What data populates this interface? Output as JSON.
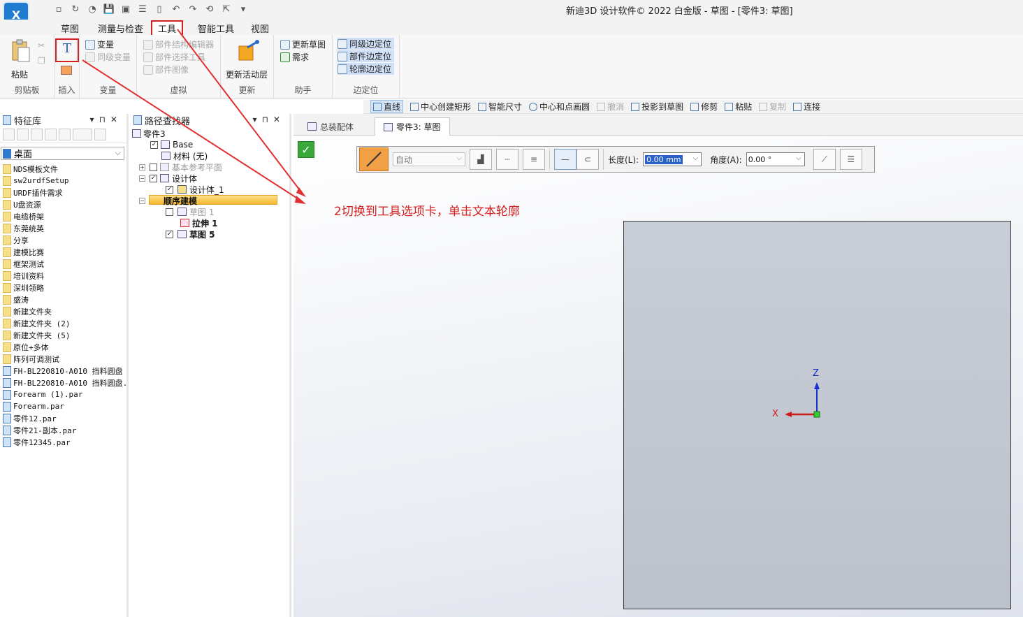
{
  "window": {
    "title": "新迪3D 设计软件© 2022 白金版 - 草图 - [零件3: 草图]"
  },
  "ribbon_tabs": [
    "草图",
    "测量与检查",
    "工具",
    "智能工具",
    "视图"
  ],
  "ribbon": {
    "clipboard": {
      "paste_label": "粘贴",
      "group_label": "剪贴板"
    },
    "insert": {
      "group_label": "插入"
    },
    "variables": {
      "var_label": "变量",
      "peer_var_label": "同级变量",
      "group_label": "变量"
    },
    "virtual": {
      "item1": "部件结构编辑器",
      "item2": "部件选择工具",
      "item3": "部件图像",
      "group_label": "虚拟"
    },
    "update": {
      "update_layer_label": "更新活动层",
      "group_label": "更新"
    },
    "assistant": {
      "update_sketch_label": "更新草图",
      "requirement_label": "需求",
      "group_label": "助手"
    },
    "edge_position": {
      "item1": "同级边定位",
      "item2": "部件边定位",
      "item3": "轮廓边定位",
      "group_label": "边定位"
    }
  },
  "sketch_commands": [
    {
      "label": "直线",
      "icon": "line-icon"
    },
    {
      "label": "中心创建矩形",
      "icon": "rectangle-icon"
    },
    {
      "label": "智能尺寸",
      "icon": "smart-dimension-icon"
    },
    {
      "label": "中心和点画圆",
      "icon": "circle-icon"
    },
    {
      "label": "撤消",
      "icon": "undo-icon"
    },
    {
      "label": "投影到草图",
      "icon": "project-icon"
    },
    {
      "label": "修剪",
      "icon": "trim-icon"
    },
    {
      "label": "粘贴",
      "icon": "paste-icon"
    },
    {
      "label": "复制",
      "icon": "copy-icon"
    },
    {
      "label": "连接",
      "icon": "connect-icon"
    }
  ],
  "feature_library": {
    "title": "特征库",
    "location": "桌面",
    "items": [
      {
        "name": "NDS模板文件",
        "type": "folder"
      },
      {
        "name": "sw2urdfSetup",
        "type": "folder"
      },
      {
        "name": "URDF插件需求",
        "type": "folder"
      },
      {
        "name": "U盘资源",
        "type": "folder"
      },
      {
        "name": "电缆桥架",
        "type": "folder"
      },
      {
        "name": "东莞统英",
        "type": "folder"
      },
      {
        "name": "分享",
        "type": "folder"
      },
      {
        "name": "建模比赛",
        "type": "folder"
      },
      {
        "name": "框架测试",
        "type": "folder"
      },
      {
        "name": "培训资料",
        "type": "folder"
      },
      {
        "name": "深圳领略",
        "type": "folder"
      },
      {
        "name": "盛涛",
        "type": "folder"
      },
      {
        "name": "新建文件夹",
        "type": "folder"
      },
      {
        "name": "新建文件夹 (2)",
        "type": "folder"
      },
      {
        "name": "新建文件夹 (5)",
        "type": "folder"
      },
      {
        "name": "原位+多体",
        "type": "folder"
      },
      {
        "name": "阵列可调测试",
        "type": "folder"
      },
      {
        "name": "FH-BL220810-A010 挡料圆盘",
        "type": "file"
      },
      {
        "name": "FH-BL220810-A010 挡料圆盘.:",
        "type": "file"
      },
      {
        "name": "Forearm (1).par",
        "type": "file"
      },
      {
        "name": "Forearm.par",
        "type": "file"
      },
      {
        "name": "零件12.par",
        "type": "file"
      },
      {
        "name": "零件21-副本.par",
        "type": "file"
      },
      {
        "name": "零件12345.par",
        "type": "file"
      }
    ]
  },
  "path_finder": {
    "title": "路径查找器",
    "root": "零件3",
    "base": "Base",
    "material": "材料 (无)",
    "ref_planes": "基本参考平面",
    "design_body": "设计体",
    "design_body_1": "设计体_1",
    "sequential": "顺序建模",
    "sketch1": "草图 1",
    "extrude1": "拉伸 1",
    "sketch5": "草图 5"
  },
  "doc_tabs": [
    "总装配体",
    "零件3: 草图"
  ],
  "line_ribbon": {
    "mode": "自动",
    "length_label": "长度(L):",
    "length_value": "0.00 mm",
    "angle_label": "角度(A):",
    "angle_value": "0.00 °"
  },
  "annotation": "2切换到工具选项卡，单击文本轮廓",
  "axes": {
    "z": "Z",
    "x": "X"
  }
}
